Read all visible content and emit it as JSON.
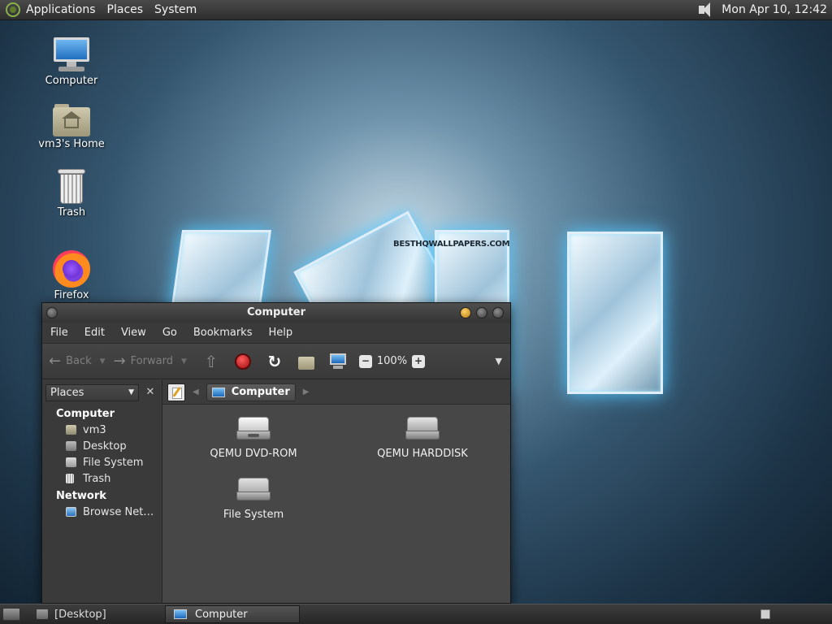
{
  "top_panel": {
    "menus": [
      "Applications",
      "Places",
      "System"
    ],
    "clock": "Mon Apr 10, 12:42"
  },
  "wallpaper": {
    "watermark": "BESTHQWALLPAPERS.COM"
  },
  "desktop_icons": [
    {
      "label": "Computer",
      "icon": "computer-icon"
    },
    {
      "label": "vm3's Home",
      "icon": "home-folder-icon"
    },
    {
      "label": "Trash",
      "icon": "trash-icon"
    },
    {
      "label": "Firefox",
      "icon": "firefox-icon"
    }
  ],
  "window": {
    "title": "Computer",
    "menu": [
      "File",
      "Edit",
      "View",
      "Go",
      "Bookmarks",
      "Help"
    ],
    "toolbar": {
      "back_label": "Back",
      "forward_label": "Forward",
      "zoom": "100%"
    },
    "sidebar": {
      "selector": "Places",
      "sections": [
        {
          "title": "Computer",
          "items": [
            "vm3",
            "Desktop",
            "File System",
            "Trash"
          ]
        },
        {
          "title": "Network",
          "items": [
            "Browse Net…"
          ]
        }
      ]
    },
    "pathbar": {
      "current": "Computer"
    },
    "items": [
      {
        "label": "QEMU DVD-ROM",
        "icon": "dvd-drive-icon"
      },
      {
        "label": "QEMU HARDDISK",
        "icon": "harddisk-icon"
      },
      {
        "label": "File System",
        "icon": "filesystem-drive-icon"
      }
    ]
  },
  "bottom_panel": {
    "tasks": [
      "[Desktop]",
      "Computer"
    ]
  },
  "colors": {
    "panel_bg": "#2e2e2e",
    "window_bg": "#3c3c3c",
    "content_bg": "#474747",
    "stop_button": "#c81a1a",
    "minimize_button": "#e0a020"
  }
}
